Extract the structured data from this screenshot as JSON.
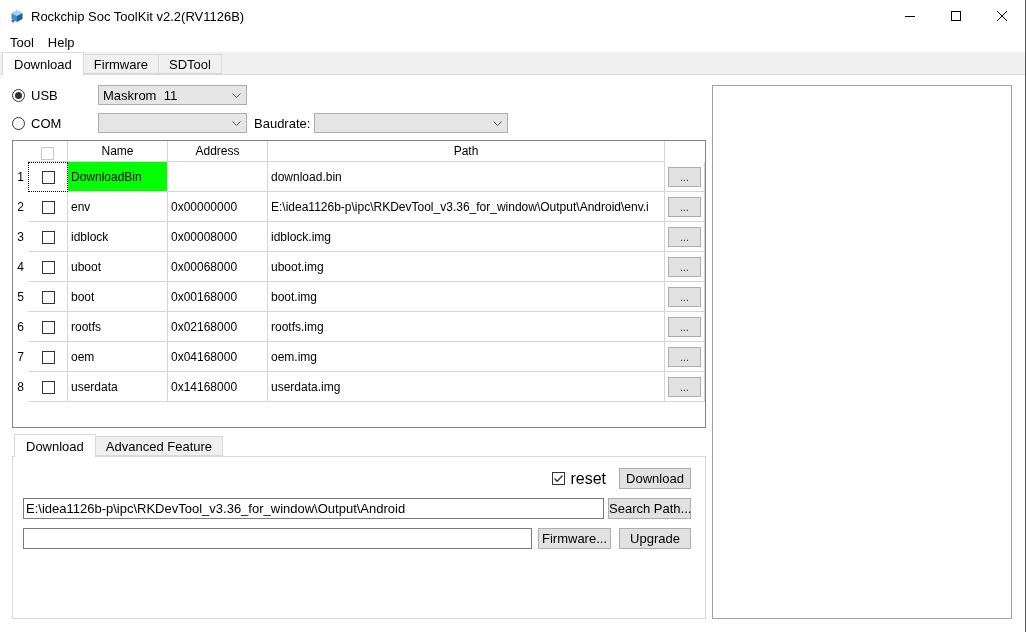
{
  "window": {
    "title": "Rockchip Soc ToolKit v2.2(RV1126B)"
  },
  "menu": [
    "Tool",
    "Help"
  ],
  "tabs": [
    {
      "label": "Download",
      "selected": true
    },
    {
      "label": "Firmware",
      "selected": false
    },
    {
      "label": "SDTool",
      "selected": false
    }
  ],
  "ports": [
    {
      "label": "USB",
      "selected": true,
      "device": "Maskrom  11"
    },
    {
      "label": "COM",
      "selected": false,
      "baudrate_label": "Baudrate:"
    }
  ],
  "table": {
    "header_checkbox": {
      "checked": false,
      "disabled": true
    },
    "columns": [
      "Name",
      "Address",
      "Path"
    ],
    "rows": [
      {
        "index": "1",
        "checked": false,
        "focused": true,
        "highlighted": true,
        "name": "DownloadBin",
        "path": "download.bin",
        "button": "..."
      },
      {
        "index": "2",
        "checked": false,
        "focused": false,
        "highlighted": false,
        "name": "env",
        "address": "0x00000000",
        "path": "E:\\idea1126b-p\\ipc\\RKDevTool_v3.36_for_window\\Output\\Android\\env.i",
        "button": "..."
      },
      {
        "index": "3",
        "checked": false,
        "focused": false,
        "highlighted": false,
        "name": "idblock",
        "address": "0x00008000",
        "path": "idblock.img",
        "button": "..."
      },
      {
        "index": "4",
        "checked": false,
        "focused": false,
        "highlighted": false,
        "name": "uboot",
        "address": "0x00068000",
        "path": "uboot.img",
        "button": "..."
      },
      {
        "index": "5",
        "checked": false,
        "focused": false,
        "highlighted": false,
        "name": "boot",
        "address": "0x00168000",
        "path": "boot.img",
        "button": "..."
      },
      {
        "index": "6",
        "checked": false,
        "focused": false,
        "highlighted": false,
        "name": "rootfs",
        "address": "0x02168000",
        "path": "rootfs.img",
        "button": "..."
      },
      {
        "index": "7",
        "checked": false,
        "focused": false,
        "highlighted": false,
        "name": "oem",
        "address": "0x04168000",
        "path": "oem.img",
        "button": "..."
      },
      {
        "index": "8",
        "checked": false,
        "focused": false,
        "highlighted": false,
        "name": "userdata",
        "address": "0x14168000",
        "path": "userdata.img",
        "button": "..."
      }
    ]
  },
  "bottom_tabs": [
    {
      "label": "Download",
      "selected": true
    },
    {
      "label": "Advanced Feature",
      "selected": false
    }
  ],
  "download_panel": {
    "reset": {
      "label": "reset",
      "checked": true
    },
    "download_button": "Download",
    "path_field": {
      "value": "E:\\idea1126b-p\\ipc\\RKDevTool_v3.36_for_window\\Output\\Android"
    },
    "search_button": "Search Path...",
    "firmware_button": "Firmware...",
    "upgrade_button": "Upgrade"
  }
}
